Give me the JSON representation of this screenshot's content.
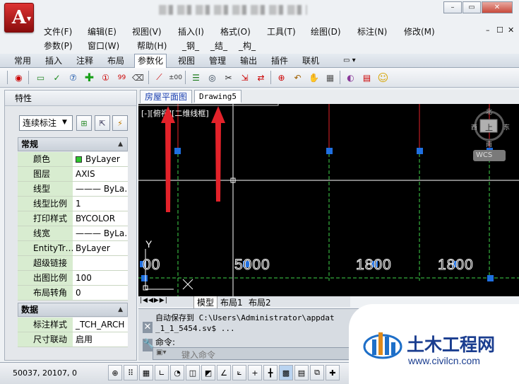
{
  "app": {
    "logo_letter": "A",
    "title_blurred": "AutoCAD"
  },
  "window_controls": [
    "–",
    "▭",
    "✕"
  ],
  "menubar": {
    "row1": [
      "文件(F)",
      "编辑(E)",
      "视图(V)",
      "插入(I)",
      "格式(O)",
      "工具(T)",
      "绘图(D)",
      "标注(N)",
      "修改(M)"
    ],
    "row2": [
      "参数(P)",
      "窗口(W)",
      "帮助(H)",
      "_钢_",
      "_结_",
      "_构_"
    ],
    "mdi_controls": [
      "–",
      "☐",
      "✕"
    ]
  },
  "ribbon_tabs": [
    "常用",
    "插入",
    "注释",
    "布局",
    "参数化",
    "视图",
    "管理",
    "输出",
    "插件",
    "联机"
  ],
  "ribbon_active": "参数化",
  "properties": {
    "title": "特性",
    "selector": "连续标注",
    "sections": [
      {
        "name": "常规",
        "rows": [
          {
            "key": "颜色",
            "value": "ByLayer"
          },
          {
            "key": "图层",
            "value": "AXIS"
          },
          {
            "key": "线型",
            "value": "——— ByLa…"
          },
          {
            "key": "线型比例",
            "value": "1"
          },
          {
            "key": "打印样式",
            "value": "BYCOLOR"
          },
          {
            "key": "线宽",
            "value": "——— ByLa…"
          },
          {
            "key": "EntityTr…",
            "value": "ByLayer"
          },
          {
            "key": "超级链接",
            "value": ""
          },
          {
            "key": "出图比例",
            "value": "100"
          },
          {
            "key": "布局转角",
            "value": "0"
          }
        ]
      },
      {
        "name": "数据",
        "rows": [
          {
            "key": "标注样式",
            "value": "_TCH_ARCH"
          },
          {
            "key": "尺寸联动",
            "value": "启用"
          }
        ]
      }
    ]
  },
  "doc_tabs": [
    "房屋平面图",
    "Drawing5"
  ],
  "viewport_label": "[-][俯视][二维线框]",
  "viewcube": {
    "top": "北",
    "west": "西",
    "east": "东",
    "south": "南",
    "center": "上",
    "wcs": "WCS"
  },
  "dimensions": [
    "00",
    "5000",
    "1800",
    "1800"
  ],
  "layout_tabs": [
    "模型",
    "布局1",
    "布局2"
  ],
  "command": {
    "line1": "自动保存到 C:\\Users\\Administrator\\appdat",
    "line2": "_1_1_5454.sv$ ...",
    "prompt": "命令:",
    "input_placeholder": "键入命令"
  },
  "status": {
    "coords": "50037, 20107, 0"
  },
  "watermark": {
    "name": "土木工程网",
    "url": "www.civilcn.com"
  },
  "colors": {
    "accent_red": "#e3222a",
    "canvas_bg": "#000000",
    "grip_blue": "#1f6fe0",
    "axis_green": "#3fd34a"
  }
}
